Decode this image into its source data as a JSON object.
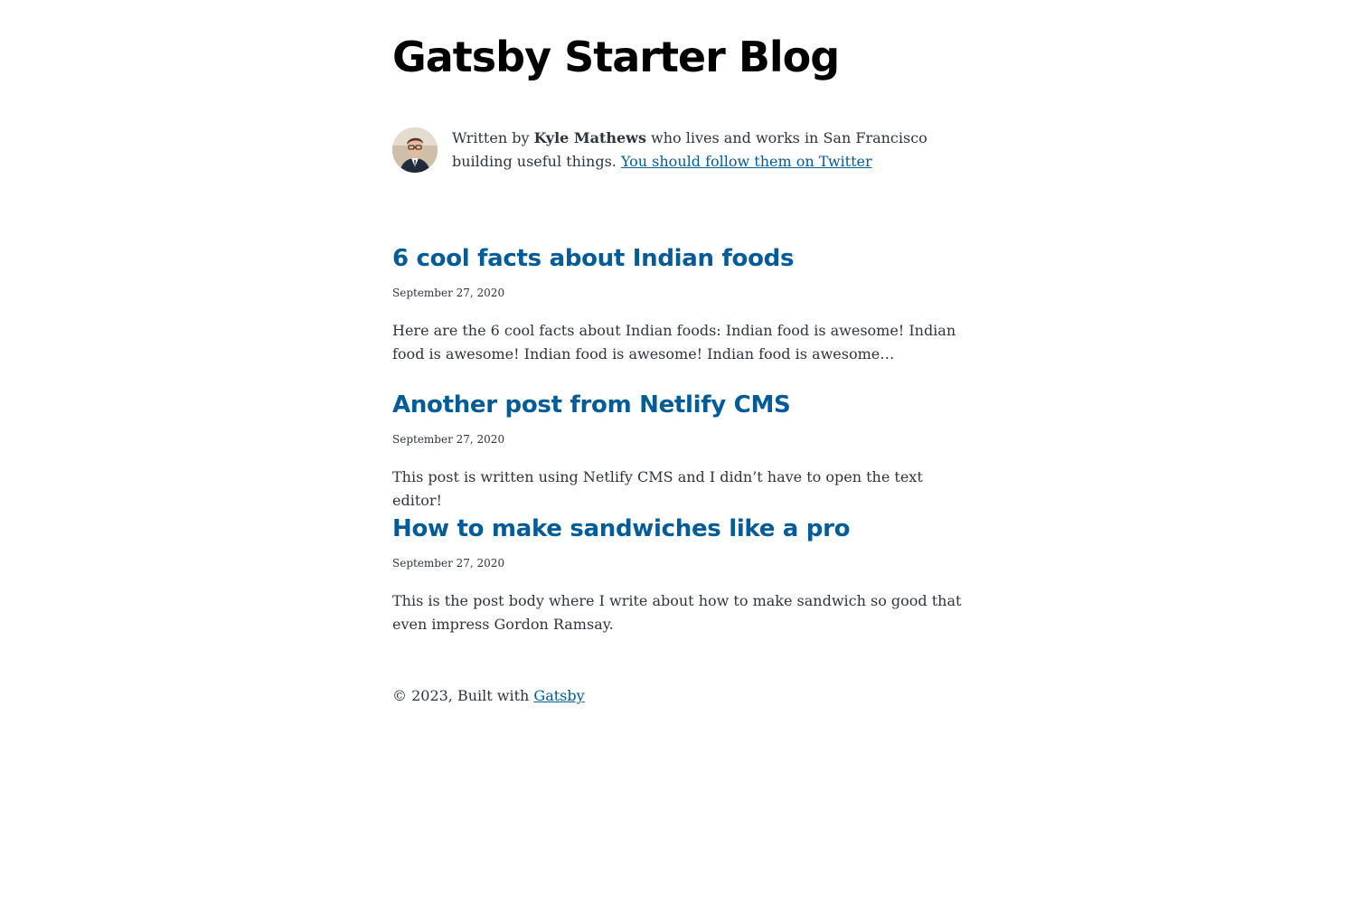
{
  "site": {
    "title": "Gatsby Starter Blog"
  },
  "bio": {
    "prefix": "Written by ",
    "author": "Kyle Mathews",
    "suffix": " who lives and works in San Francisco building useful things. ",
    "twitter_link": "You should follow them on Twitter",
    "avatar_icon": "author-avatar"
  },
  "posts": [
    {
      "title": "6 cool facts about Indian foods",
      "date": "September 27, 2020",
      "description": "Here are the 6 cool facts about Indian foods: Indian food is awesome! Indian food is awesome! Indian food is awesome! Indian food is awesome…"
    },
    {
      "title": "Another post from Netlify CMS",
      "date": "September 27, 2020",
      "description": "This post is written using Netlify CMS and I didn’t have to open the text editor!"
    },
    {
      "title": "How to make sandwiches like a pro",
      "date": "September 27, 2020",
      "description": "This is the post body where I write about how to make sandwich so good that even impress Gordon Ramsay."
    }
  ],
  "footer": {
    "text": "© 2023, Built with ",
    "link": "Gatsby"
  },
  "colors": {
    "link": "#005b99",
    "text": "#2e353f",
    "heading": "#000000"
  }
}
